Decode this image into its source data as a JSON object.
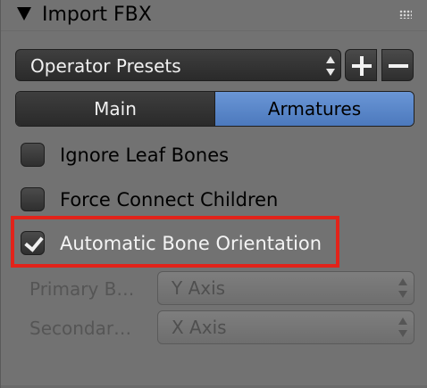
{
  "panel": {
    "title": "Import FBX",
    "collapse_icon": "disclosure-triangle-down",
    "drag_icon": "grip-dots"
  },
  "presets": {
    "label": "Operator Presets",
    "add_icon": "plus",
    "remove_icon": "minus"
  },
  "tabs": [
    {
      "label": "Main",
      "active": false
    },
    {
      "label": "Armatures",
      "active": true
    }
  ],
  "options": [
    {
      "label": "Ignore Leaf Bones",
      "checked": false
    },
    {
      "label": "Force Connect Children",
      "checked": false
    },
    {
      "label": "Automatic Bone Orientation",
      "checked": true
    }
  ],
  "highlight_color": "#e2231a",
  "accent_color": "#5a87cb",
  "primary_bone": {
    "label": "Primary B…",
    "value": "Y Axis",
    "enabled": false
  },
  "secondary_bone": {
    "label": "Secondar…",
    "value": "X Axis",
    "enabled": false
  }
}
